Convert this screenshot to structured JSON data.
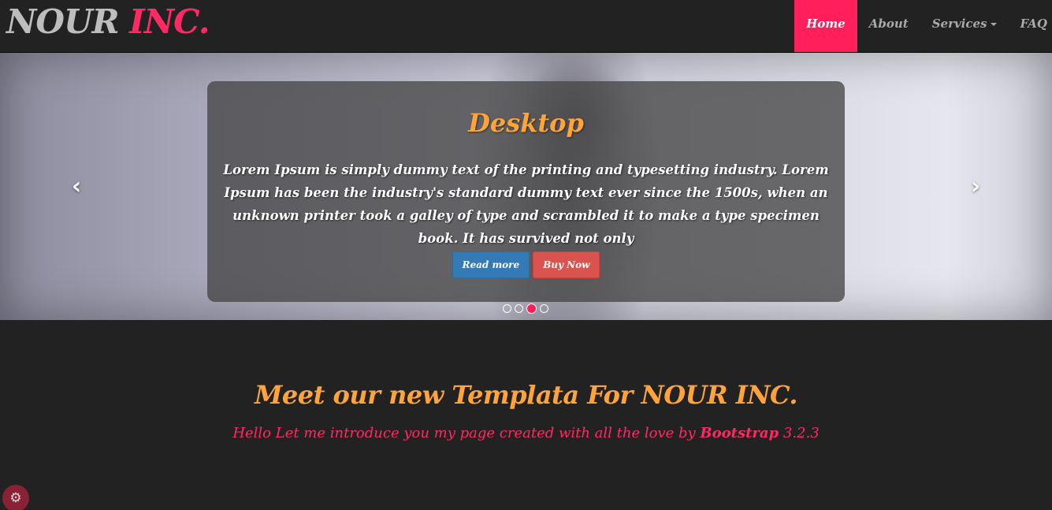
{
  "brand": {
    "part1": "NOUR",
    "part2": "INC."
  },
  "nav": {
    "items": [
      {
        "label": "Home"
      },
      {
        "label": "About"
      },
      {
        "label": "Services"
      },
      {
        "label": "FAQ"
      }
    ],
    "active_index": 0
  },
  "carousel": {
    "title": "Desktop",
    "text": "Lorem Ipsum is simply dummy text of the printing and typesetting industry. Lorem Ipsum has been the industry's standard dummy text ever since the 1500s, when an unknown printer took a galley of type and scrambled it to make a type specimen book. It has survived not only",
    "buttons": {
      "read_more": "Read more",
      "buy_now": "Buy Now"
    },
    "prev_icon": "‹",
    "next_icon": "›",
    "slide_count": 4,
    "active_slide": 2
  },
  "intro": {
    "title": "Meet our new Templata For NOUR INC.",
    "subtitle_prefix": "Hello Let me introduce you my page created with all the love by",
    "subtitle_bold": "Bootstrap",
    "subtitle_suffix": "3.2.3"
  },
  "settings": {
    "icon": "gear-icon"
  },
  "colors": {
    "accent": "#ff1f5a",
    "orange": "#ffa43a",
    "background": "#222222"
  }
}
